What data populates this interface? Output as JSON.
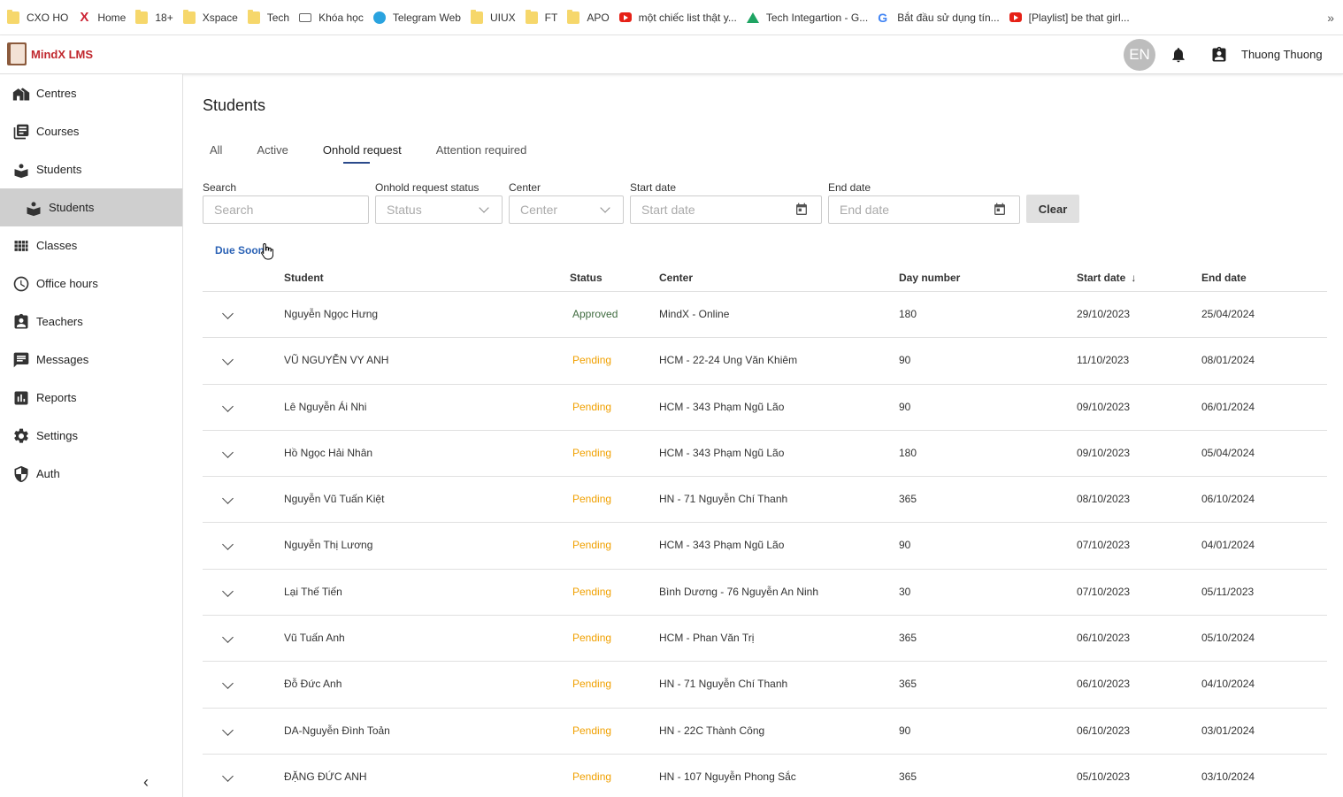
{
  "bookmarks": [
    {
      "label": "CXO HO",
      "icon": "folder-icon"
    },
    {
      "label": "Home",
      "icon": "x-icon"
    },
    {
      "label": "18+",
      "icon": "folder-icon"
    },
    {
      "label": "Xspace",
      "icon": "folder-icon"
    },
    {
      "label": "Tech",
      "icon": "folder-icon"
    },
    {
      "label": "Khóa học",
      "icon": "page-icon"
    },
    {
      "label": "Telegram Web",
      "icon": "telegram-icon"
    },
    {
      "label": "UIUX",
      "icon": "folder-icon"
    },
    {
      "label": "FT",
      "icon": "folder-icon"
    },
    {
      "label": "APO",
      "icon": "folder-icon"
    },
    {
      "label": "một chiếc list thật y...",
      "icon": "youtube-icon"
    },
    {
      "label": "Tech Integartion - G...",
      "icon": "drive-icon"
    },
    {
      "label": "Bắt đầu sử dụng tín...",
      "icon": "google-icon"
    },
    {
      "label": "[Playlist] be that girl...",
      "icon": "youtube-icon"
    }
  ],
  "bookmarks_more": "»",
  "app": {
    "name": "MindX LMS",
    "brand_color": "#c0272d"
  },
  "header": {
    "lang": "EN",
    "username": "Thuong Thuong"
  },
  "sidebar": {
    "items": [
      {
        "label": "Centres"
      },
      {
        "label": "Courses"
      },
      {
        "label": "Students"
      },
      {
        "label": "Students"
      },
      {
        "label": "Classes"
      },
      {
        "label": "Office hours"
      },
      {
        "label": "Teachers"
      },
      {
        "label": "Messages"
      },
      {
        "label": "Reports"
      },
      {
        "label": "Settings"
      },
      {
        "label": "Auth"
      }
    ],
    "collapse": "‹"
  },
  "page": {
    "title": "Students"
  },
  "tabs": [
    {
      "label": "All"
    },
    {
      "label": "Active"
    },
    {
      "label": "Onhold request"
    },
    {
      "label": "Attention required"
    }
  ],
  "filters": {
    "search_label": "Search",
    "search_placeholder": "Search",
    "status_label": "Onhold request status",
    "status_placeholder": "Status",
    "center_label": "Center",
    "center_placeholder": "Center",
    "start_label": "Start date",
    "start_placeholder": "Start date",
    "end_label": "End date",
    "end_placeholder": "End date",
    "clear": "Clear"
  },
  "due_soon": "Due Soon",
  "table": {
    "headers": [
      "Student",
      "Status",
      "Center",
      "Day number",
      "Start date",
      "End date"
    ],
    "sort_arrow": "↓",
    "rows": [
      {
        "student": "Nguyễn Ngọc Hưng",
        "status": "Approved",
        "center": "MindX - Online",
        "days": "180",
        "start": "29/10/2023",
        "end": "25/04/2024"
      },
      {
        "student": "VŨ NGUYỄN VY ANH",
        "status": "Pending",
        "center": "HCM - 22-24 Ung Văn Khiêm",
        "days": "90",
        "start": "11/10/2023",
        "end": "08/01/2024"
      },
      {
        "student": "Lê Nguyễn Ái Nhi",
        "status": "Pending",
        "center": "HCM - 343 Phạm Ngũ Lão",
        "days": "90",
        "start": "09/10/2023",
        "end": "06/01/2024"
      },
      {
        "student": "Hồ Ngọc Hải Nhân",
        "status": "Pending",
        "center": "HCM - 343 Phạm Ngũ Lão",
        "days": "180",
        "start": "09/10/2023",
        "end": "05/04/2024"
      },
      {
        "student": "Nguyễn Vũ Tuấn Kiệt",
        "status": "Pending",
        "center": "HN - 71 Nguyễn Chí Thanh",
        "days": "365",
        "start": "08/10/2023",
        "end": "06/10/2024"
      },
      {
        "student": "Nguyễn Thị Lương",
        "status": "Pending",
        "center": "HCM - 343 Phạm Ngũ Lão",
        "days": "90",
        "start": "07/10/2023",
        "end": "04/01/2024"
      },
      {
        "student": "Lại Thế Tiến",
        "status": "Pending",
        "center": "Bình Dương - 76 Nguyễn An Ninh",
        "days": "30",
        "start": "07/10/2023",
        "end": "05/11/2023"
      },
      {
        "student": "Vũ Tuấn Anh",
        "status": "Pending",
        "center": "HCM - Phan Văn Trị",
        "days": "365",
        "start": "06/10/2023",
        "end": "05/10/2024"
      },
      {
        "student": "Đỗ Đức Anh",
        "status": "Pending",
        "center": "HN - 71 Nguyễn Chí Thanh",
        "days": "365",
        "start": "06/10/2023",
        "end": "04/10/2024"
      },
      {
        "student": "DA-Nguyễn Đình Toản",
        "status": "Pending",
        "center": "HN - 22C Thành Công",
        "days": "90",
        "start": "06/10/2023",
        "end": "03/01/2024"
      },
      {
        "student": "ĐẶNG ĐỨC ANH",
        "status": "Pending",
        "center": "HN - 107 Nguyễn Phong Sắc",
        "days": "365",
        "start": "05/10/2023",
        "end": "03/10/2024"
      }
    ]
  },
  "colors": {
    "approved": "#3f6b3f",
    "pending": "#f0a000",
    "accent": "#2b4a8b",
    "link": "#2b62b5"
  }
}
